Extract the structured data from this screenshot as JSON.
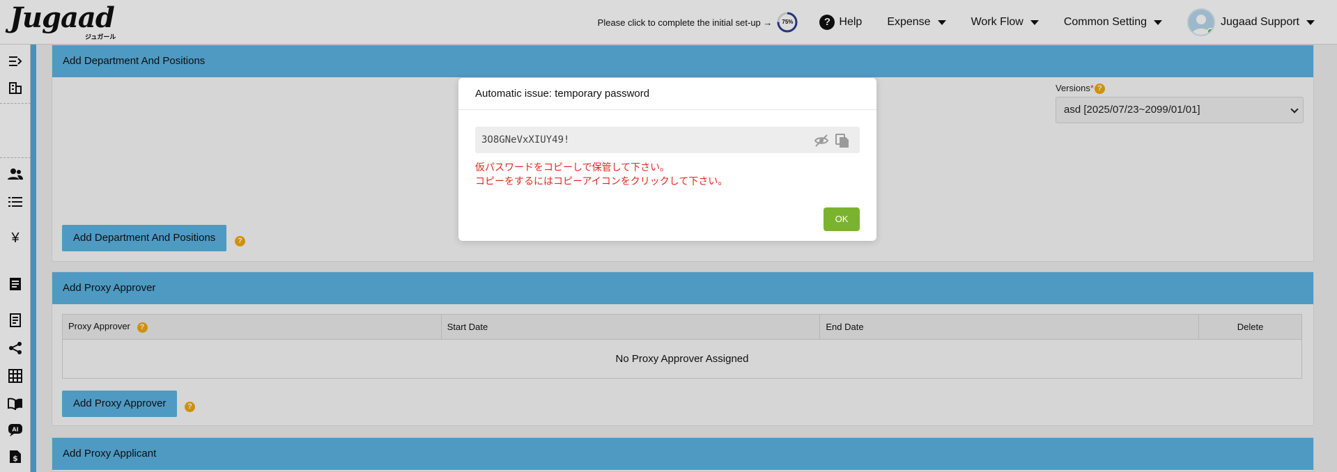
{
  "header": {
    "logo_text": "Jugaad",
    "logo_sub": "ジュガール",
    "setup_text": "Please click to complete the initial set-up →",
    "setup_progress": "75%",
    "setup_progress_value": 75,
    "help_label": "Help",
    "nav": [
      "Expense",
      "Work Flow",
      "Common Setting"
    ],
    "user_name": "Jugaad Support"
  },
  "sidebar": {
    "icons": [
      "menu-expand-icon",
      "building-icon",
      "users-icon",
      "list-icon",
      "yen-icon",
      "document-icon",
      "receipt-icon",
      "share-icon",
      "grid-icon",
      "book-icon",
      "ai-chat-icon",
      "invoice-icon"
    ]
  },
  "dept_panel": {
    "title": "Add Department And Positions",
    "versions_label": "Versions",
    "required_mark": "*",
    "versions_value": "asd [2025/07/23~2099/01/01]",
    "add_button": "Add Department And Positions"
  },
  "proxy_approver": {
    "title": "Add Proxy Approver",
    "columns": [
      "Proxy Approver",
      "Start Date",
      "End Date",
      "Delete"
    ],
    "empty_message": "No Proxy Approver Assigned",
    "add_button": "Add Proxy Approver"
  },
  "proxy_applicant": {
    "title": "Add Proxy Applicant"
  },
  "modal": {
    "title": "Automatic issue: temporary password",
    "password": "3O8GNeVxXIUY49!",
    "message_line1": "仮パスワードをコピーしで保管して下さい。",
    "message_line2": "コピーをするにはコピーアイコンをクリックして下さい。",
    "ok_label": "OK"
  },
  "colors": {
    "accent_blue": "#5bb4e3",
    "ok_green": "#7bb32e",
    "error_red": "#e5261d",
    "help_badge": "#f2a90c"
  }
}
